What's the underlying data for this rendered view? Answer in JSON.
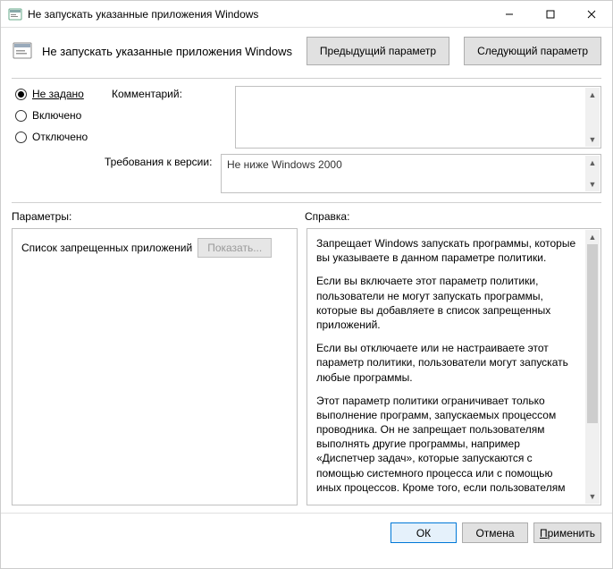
{
  "window": {
    "title": "Не запускать указанные приложения Windows"
  },
  "subheader": {
    "title": "Не запускать указанные приложения Windows",
    "prev_btn": "Предыдущий параметр",
    "next_btn": "Следующий параметр"
  },
  "radios": {
    "not_configured": "Не задано",
    "enabled": "Включено",
    "disabled": "Отключено",
    "selected": "not_configured"
  },
  "labels": {
    "comment": "Комментарий:",
    "requirement": "Требования к версии:",
    "parameters": "Параметры:",
    "help": "Справка:",
    "blocked_list": "Список запрещенных приложений",
    "show_btn": "Показать..."
  },
  "fields": {
    "comment_value": "",
    "requirement_value": "Не ниже Windows 2000"
  },
  "help": {
    "p1": "Запрещает Windows запускать программы, которые вы указываете в данном параметре политики.",
    "p2": "Если вы включаете этот параметр политики, пользователи не могут запускать программы, которые вы добавляете в список запрещенных приложений.",
    "p3": "Если вы отключаете или не настраиваете этот параметр политики, пользователи могут запускать любые программы.",
    "p4": "Этот параметр политики ограничивает только выполнение программ, запускаемых процессом проводника. Он не запрещает пользователям выполнять другие программы, например «Диспетчер задач», которые запускаются с помощью системного процесса или с помощью иных процессов.  Кроме того, если пользователям разрешен доступ к командной строке (Cmd.exe), этот параметр политики не запрещает им запускать из окна командной строки даже те программы, которые им не разрешено запускать с помощью проводника."
  },
  "footer": {
    "ok": "ОК",
    "cancel": "Отмена",
    "apply": "Применить"
  }
}
